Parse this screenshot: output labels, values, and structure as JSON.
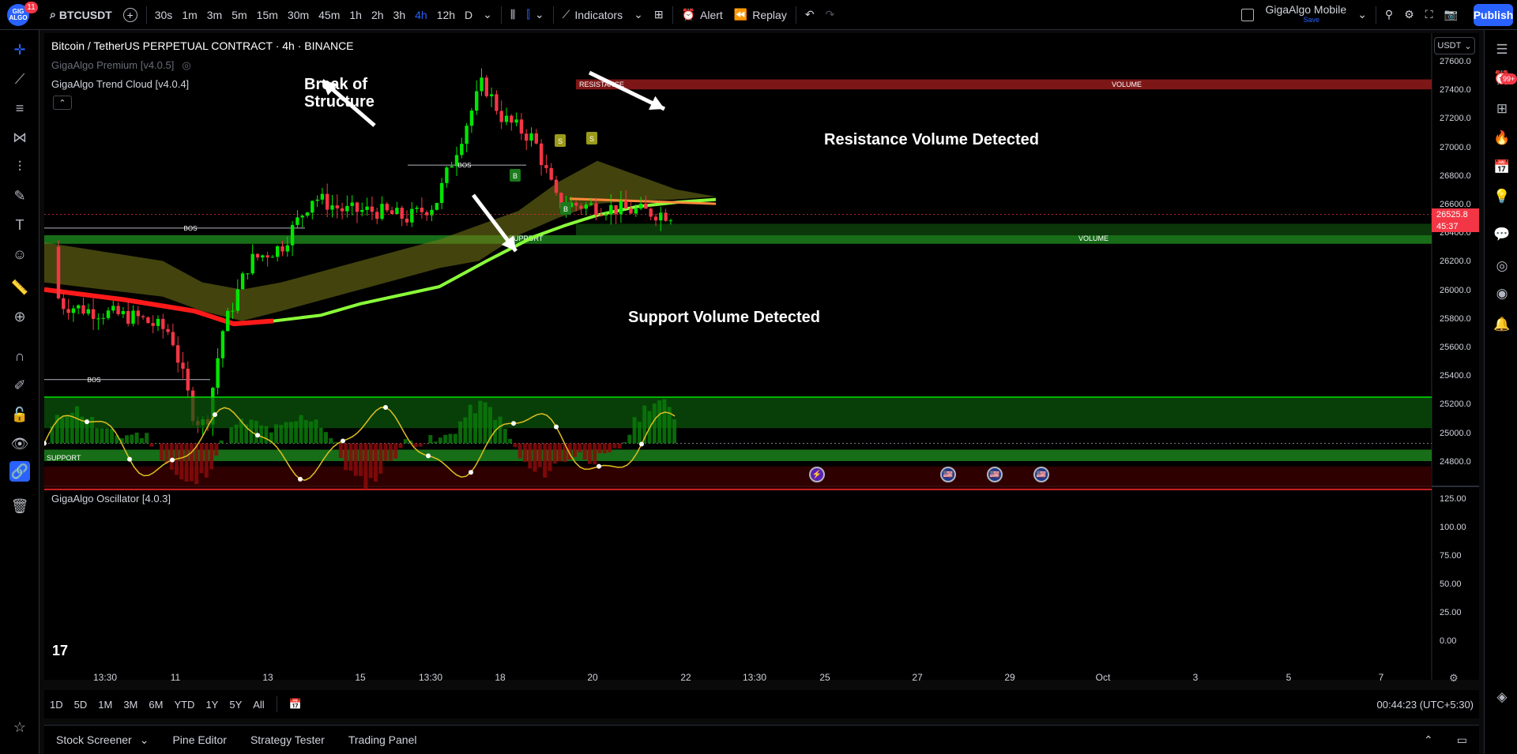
{
  "app": {
    "logo_text": "GIG ALGO",
    "logo_badge": "11",
    "symbol": "BTCUSDT",
    "timeframes": [
      "30s",
      "1m",
      "3m",
      "5m",
      "15m",
      "30m",
      "45m",
      "1h",
      "2h",
      "3h",
      "4h",
      "12h",
      "D"
    ],
    "active_timeframe": "4h",
    "indicators_label": "Indicators",
    "alert_label": "Alert",
    "replay_label": "Replay",
    "layout_name": "GigaAlgo Mobile",
    "layout_sub": "Save",
    "publish_label": "Publish"
  },
  "right_badge": "99+",
  "chart": {
    "title": "Bitcoin / TetherUS PERPETUAL CONTRACT · 4h · BINANCE",
    "currency": "USDT",
    "legend1": "GigaAlgo Premium [v4.0.5]",
    "legend2": "GigaAlgo Trend Cloud [v4.0.4]",
    "osc_title": "GigaAlgo Oscillator [4.0.3]",
    "price_levels": [
      "27600.0",
      "27400.0",
      "27200.0",
      "27000.0",
      "26800.0",
      "26600.0",
      "26400.0",
      "26200.0",
      "26000.0",
      "25800.0",
      "25600.0",
      "25400.0",
      "25200.0",
      "25000.0",
      "24800.0"
    ],
    "last_price": "26525.8",
    "countdown": "45:37",
    "osc_levels": [
      "125.00",
      "100.00",
      "75.00",
      "50.00",
      "25.00",
      "0.00"
    ],
    "x_labels": [
      "13:30",
      "11",
      "13",
      "15",
      "13:30",
      "18",
      "20",
      "22",
      "13:30",
      "25",
      "27",
      "29",
      "Oct",
      "3",
      "5",
      "7"
    ],
    "zones": {
      "resistance": "RESISTANCE",
      "volume_top": "VOLUME",
      "support_mid": "SUPPORT",
      "volume_mid": "VOLUME",
      "support_low": "SUPPORT"
    },
    "bos": [
      "BOS",
      "BOS",
      "BOS"
    ],
    "signals": {
      "s": "S",
      "b": "B"
    },
    "annotations": {
      "bos": [
        "Break of",
        "Structure"
      ],
      "resistance": "Resistance Volume Detected",
      "support": "Support Volume Detected"
    },
    "tv_logo": "17"
  },
  "ranges": [
    "1D",
    "5D",
    "1M",
    "3M",
    "6M",
    "YTD",
    "1Y",
    "5Y",
    "All"
  ],
  "clock": "00:44:23 (UTC+5:30)",
  "footer_tabs": [
    "Stock Screener",
    "Pine Editor",
    "Strategy Tester",
    "Trading Panel"
  ],
  "colors": {
    "up": "#00e600",
    "down": "#f23645",
    "accent": "#2962ff",
    "zone_green": "#1b7a1b",
    "zone_red": "#8b1a1a"
  },
  "chart_data": {
    "type": "candlestick",
    "series": [
      {
        "name": "BTCUSDT 4h",
        "points": [
          {
            "x": "Sep 9",
            "o": 26300,
            "h": 26400,
            "l": 25800,
            "c": 25900
          },
          {
            "x": "Sep 10",
            "o": 25850,
            "h": 25900,
            "l": 25700,
            "c": 25800
          },
          {
            "x": "Sep 11",
            "o": 25800,
            "h": 25850,
            "l": 24900,
            "c": 25000
          },
          {
            "x": "Sep 11b",
            "o": 25000,
            "h": 25700,
            "l": 24950,
            "c": 25650
          },
          {
            "x": "Sep 12",
            "o": 25650,
            "h": 26200,
            "l": 25600,
            "c": 26150
          },
          {
            "x": "Sep 13",
            "o": 26100,
            "h": 26300,
            "l": 25900,
            "c": 26200
          },
          {
            "x": "Sep 14",
            "o": 26200,
            "h": 26650,
            "l": 26150,
            "c": 26600
          },
          {
            "x": "Sep 15",
            "o": 26550,
            "h": 26700,
            "l": 26450,
            "c": 26600
          },
          {
            "x": "Sep 16",
            "o": 26600,
            "h": 26700,
            "l": 26500,
            "c": 26550
          },
          {
            "x": "Sep 17",
            "o": 26550,
            "h": 26600,
            "l": 26450,
            "c": 26500
          },
          {
            "x": "Sep 18",
            "o": 26500,
            "h": 27300,
            "l": 26400,
            "c": 27200
          },
          {
            "x": "Sep 19",
            "o": 27200,
            "h": 27450,
            "l": 27000,
            "c": 27300
          },
          {
            "x": "Sep 20",
            "o": 27300,
            "h": 27400,
            "l": 26900,
            "c": 27000
          },
          {
            "x": "Sep 21",
            "o": 27000,
            "h": 27100,
            "l": 26400,
            "c": 26550
          },
          {
            "x": "Sep 22",
            "o": 26550,
            "h": 26700,
            "l": 26500,
            "c": 26600
          },
          {
            "x": "Sep 23",
            "o": 26600,
            "h": 26650,
            "l": 26550,
            "c": 26580
          },
          {
            "x": "Sep 24",
            "o": 26580,
            "h": 26750,
            "l": 26450,
            "c": 26525.8
          }
        ]
      }
    ],
    "xlabel": "",
    "ylabel": "",
    "ylim": [
      24700,
      27700
    ],
    "grid": false
  }
}
